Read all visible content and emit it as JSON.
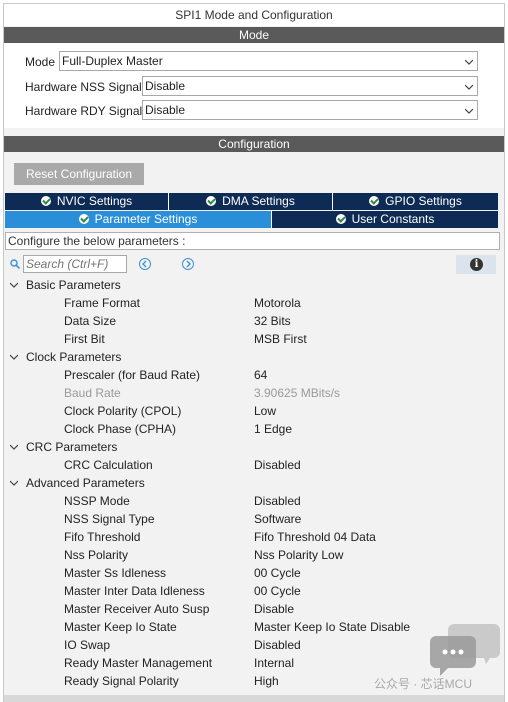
{
  "window": {
    "title": "SPI1 Mode and Configuration"
  },
  "mode_section": {
    "header": "Mode",
    "fields": [
      {
        "label": "Mode",
        "value": "Full-Duplex Master"
      },
      {
        "label": "Hardware NSS Signal",
        "value": "Disable"
      },
      {
        "label": "Hardware RDY Signal",
        "value": "Disable"
      }
    ]
  },
  "config_section": {
    "header": "Configuration",
    "reset_label": "Reset Configuration",
    "tabs_row1": [
      {
        "label": "NVIC Settings"
      },
      {
        "label": "DMA Settings"
      },
      {
        "label": "GPIO Settings"
      }
    ],
    "tabs_row2": [
      {
        "label": "Parameter Settings",
        "active": true
      },
      {
        "label": "User Constants"
      }
    ],
    "banner": "Configure the below parameters :",
    "search": {
      "placeholder": "Search (Ctrl+F)"
    },
    "icons": {
      "search": "search-icon",
      "prev": "chevron-left-icon",
      "next": "chevron-right-icon",
      "info": "info-icon"
    },
    "accent_color": "#2a8fd8",
    "tab_color": "#0d2b55"
  },
  "groups": [
    {
      "title": "Basic Parameters",
      "params": [
        {
          "name": "Frame Format",
          "value": "Motorola"
        },
        {
          "name": "Data Size",
          "value": "32 Bits"
        },
        {
          "name": "First Bit",
          "value": "MSB First"
        }
      ]
    },
    {
      "title": "Clock Parameters",
      "params": [
        {
          "name": "Prescaler (for Baud Rate)",
          "value": "64"
        },
        {
          "name": "Baud Rate",
          "value": "3.90625 MBits/s",
          "disabled": true
        },
        {
          "name": "Clock Polarity (CPOL)",
          "value": "Low"
        },
        {
          "name": "Clock Phase (CPHA)",
          "value": "1 Edge"
        }
      ]
    },
    {
      "title": "CRC Parameters",
      "params": [
        {
          "name": "CRC Calculation",
          "value": "Disabled"
        }
      ]
    },
    {
      "title": "Advanced Parameters",
      "params": [
        {
          "name": "NSSP Mode",
          "value": "Disabled"
        },
        {
          "name": "NSS Signal Type",
          "value": "Software"
        },
        {
          "name": "Fifo Threshold",
          "value": "Fifo Threshold 04 Data"
        },
        {
          "name": "Nss Polarity",
          "value": "Nss Polarity Low"
        },
        {
          "name": "Master Ss Idleness",
          "value": "00 Cycle"
        },
        {
          "name": "Master Inter Data Idleness",
          "value": "00 Cycle"
        },
        {
          "name": "Master Receiver Auto Susp",
          "value": "Disable"
        },
        {
          "name": "Master Keep Io State",
          "value": "Master Keep Io State Disable"
        },
        {
          "name": "IO Swap",
          "value": "Disabled"
        },
        {
          "name": "Ready Master Management",
          "value": "Internal"
        },
        {
          "name": "Ready Signal Polarity",
          "value": "High"
        }
      ]
    }
  ],
  "watermark": {
    "text": "公众号 · 芯话MCU"
  }
}
